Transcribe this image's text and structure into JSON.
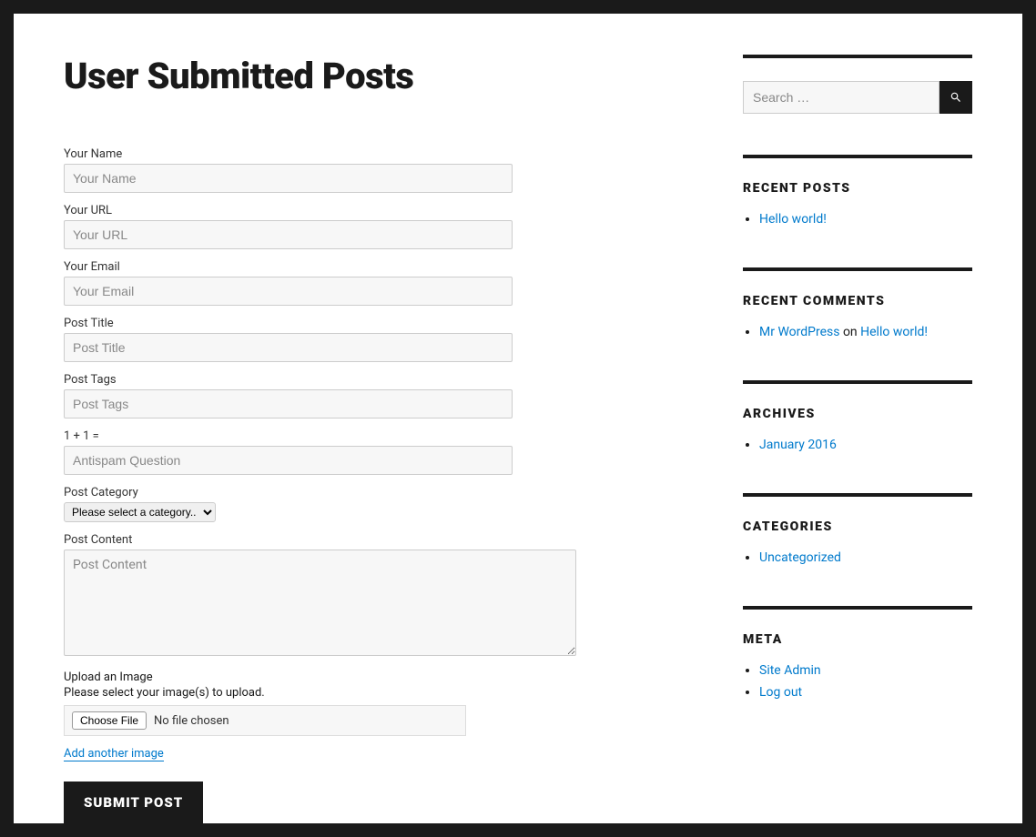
{
  "page": {
    "title": "User Submitted Posts"
  },
  "form": {
    "name": {
      "label": "Your Name",
      "placeholder": "Your Name"
    },
    "url": {
      "label": "Your URL",
      "placeholder": "Your URL"
    },
    "email": {
      "label": "Your Email",
      "placeholder": "Your Email"
    },
    "postTitle": {
      "label": "Post Title",
      "placeholder": "Post Title"
    },
    "postTags": {
      "label": "Post Tags",
      "placeholder": "Post Tags"
    },
    "antispam": {
      "label": "1 + 1 =",
      "placeholder": "Antispam Question"
    },
    "category": {
      "label": "Post Category",
      "selected": "Please select a category.."
    },
    "content": {
      "label": "Post Content",
      "placeholder": "Post Content"
    },
    "upload": {
      "label": "Upload an Image",
      "hint": "Please select your image(s) to upload.",
      "chooseButton": "Choose File",
      "noFile": "No file chosen"
    },
    "addImage": "Add another image",
    "submit": "SUBMIT POST"
  },
  "sidebar": {
    "search": {
      "placeholder": "Search …"
    },
    "recentPosts": {
      "title": "RECENT POSTS",
      "items": [
        "Hello world!"
      ]
    },
    "recentComments": {
      "title": "RECENT COMMENTS",
      "author": "Mr WordPress",
      "on": " on ",
      "post": "Hello world!"
    },
    "archives": {
      "title": "ARCHIVES",
      "items": [
        "January 2016"
      ]
    },
    "categories": {
      "title": "CATEGORIES",
      "items": [
        "Uncategorized"
      ]
    },
    "meta": {
      "title": "META",
      "items": [
        "Site Admin",
        "Log out"
      ]
    }
  }
}
